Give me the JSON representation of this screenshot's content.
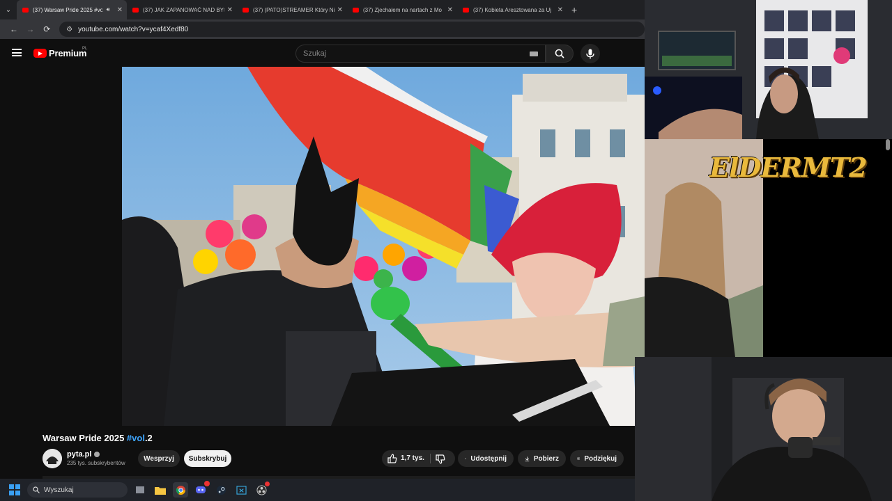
{
  "browser": {
    "tabs": [
      {
        "label": "(37) Warsaw Pride 2025 #vo",
        "active": true,
        "audio": true
      },
      {
        "label": "(37) JAK ZAPANOWAĆ NAD BYt",
        "active": false
      },
      {
        "label": "(37) (PATO)STREAMER Który Ni",
        "active": false
      },
      {
        "label": "(37) Zjechałem na nartach z Mo",
        "active": false
      },
      {
        "label": "(37) Kobieta Aresztowana za Uj",
        "active": false
      }
    ],
    "url": "youtube.com/watch?v=ycaf4Xedf80"
  },
  "youtube": {
    "brand": "Premium",
    "country": "PL",
    "search_placeholder": "Szukaj"
  },
  "video": {
    "title_prefix": "Warsaw Pride 2025 ",
    "title_tag": "#vol",
    "title_suffix": ".2",
    "channel": "pyta.pl",
    "subscribers": "235 tys. subskrybentów",
    "support_label": "Wesprzyj",
    "subscribe_label": "Subskrybuj",
    "likes": "1,7 tys.",
    "share_label": "Udostępnij",
    "download_label": "Pobierz",
    "thanks_label": "Podziękuj"
  },
  "overlay": {
    "logo_text": "ElDERMT2"
  },
  "taskbar": {
    "search_placeholder": "Wyszukaj"
  },
  "colors": {
    "youtube_red": "#ff0000",
    "link_blue": "#3ea6ff",
    "logo_gold": "#e9b93c"
  }
}
